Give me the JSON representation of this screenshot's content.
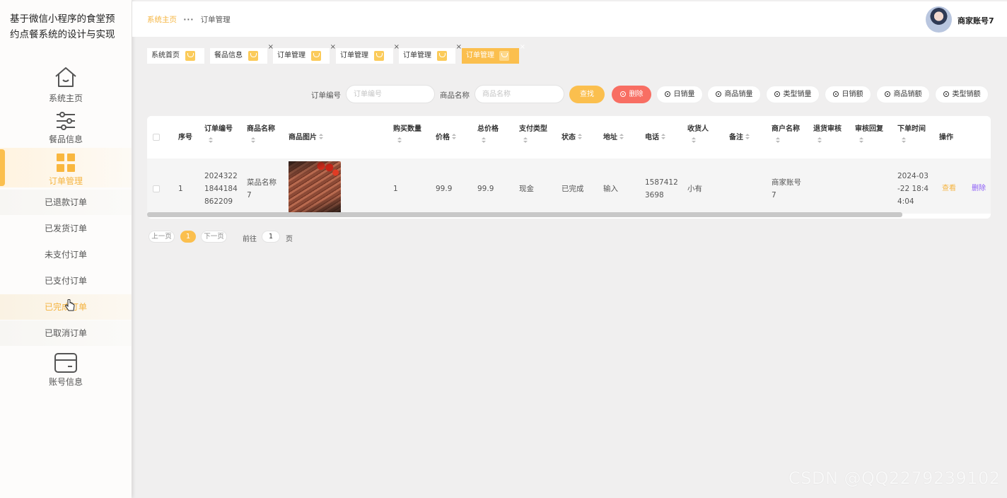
{
  "app": {
    "title": "基于微信小程序的食堂预约点餐系统的设计与实现"
  },
  "sidebar": {
    "items": [
      {
        "label": "系统主页",
        "icon": "home-icon"
      },
      {
        "label": "餐品信息",
        "icon": "sliders-icon"
      },
      {
        "label": "订单管理",
        "icon": "grid-icon",
        "active": true
      },
      {
        "label": "账号信息",
        "icon": "card-icon"
      }
    ],
    "subitems": [
      {
        "label": "已退款订单"
      },
      {
        "label": "已发货订单"
      },
      {
        "label": "未支付订单"
      },
      {
        "label": "已支付订单"
      },
      {
        "label": "已完成订单",
        "hover": true
      },
      {
        "label": "已取消订单"
      }
    ]
  },
  "header": {
    "breadcrumb": {
      "home": "系统主页",
      "current": "订单管理"
    },
    "user": "商家账号7"
  },
  "tabs": [
    {
      "label": "系统首页",
      "closable": false
    },
    {
      "label": "餐品信息",
      "closable": true
    },
    {
      "label": "订单管理",
      "closable": true
    },
    {
      "label": "订单管理",
      "closable": true
    },
    {
      "label": "订单管理",
      "closable": true
    },
    {
      "label": "订单管理",
      "closable": true,
      "active": true
    }
  ],
  "search": {
    "order_no_label": "订单编号",
    "order_no_placeholder": "订单编号",
    "product_label": "商品名称",
    "product_placeholder": "商品名称",
    "find": "查找",
    "delete": "删除",
    "stats": [
      "日销量",
      "商品销量",
      "类型销量",
      "日销额",
      "商品销额",
      "类型销额"
    ]
  },
  "table": {
    "headers": [
      "序号",
      "订单编号",
      "商品名称",
      "商品图片",
      "购买数量",
      "价格",
      "总价格",
      "支付类型",
      "状态",
      "地址",
      "电话",
      "收货人",
      "备注",
      "商户名称",
      "退货审核",
      "审核回复",
      "下单时间",
      "操作"
    ],
    "rows": [
      {
        "index": "1",
        "order_no": [
          "2024322",
          "1844184",
          "862209"
        ],
        "product": [
          "菜品名称",
          "7"
        ],
        "quantity": "1",
        "price": "99.9",
        "total": "99.9",
        "pay_type": "现金",
        "status": "已完成",
        "address": "输入",
        "phone": [
          "1587412",
          "3698"
        ],
        "receiver": "小有",
        "remark": "",
        "merchant": [
          "商家账号",
          "7"
        ],
        "return_review": "",
        "review_reply": "",
        "order_time": [
          "2024-03",
          "-22 18:4",
          "4:04"
        ],
        "view": "查看",
        "del": "删除"
      }
    ]
  },
  "pagination": {
    "prev": "上一页",
    "current": "1",
    "next": "下一页",
    "goto": "前往",
    "page_input": "1",
    "page_unit": "页"
  },
  "watermark": "CSDN @QQ2279239102",
  "colors": {
    "accent": "#fbbf4e",
    "danger": "#f86e63",
    "link_delete": "#8b5cf6"
  }
}
